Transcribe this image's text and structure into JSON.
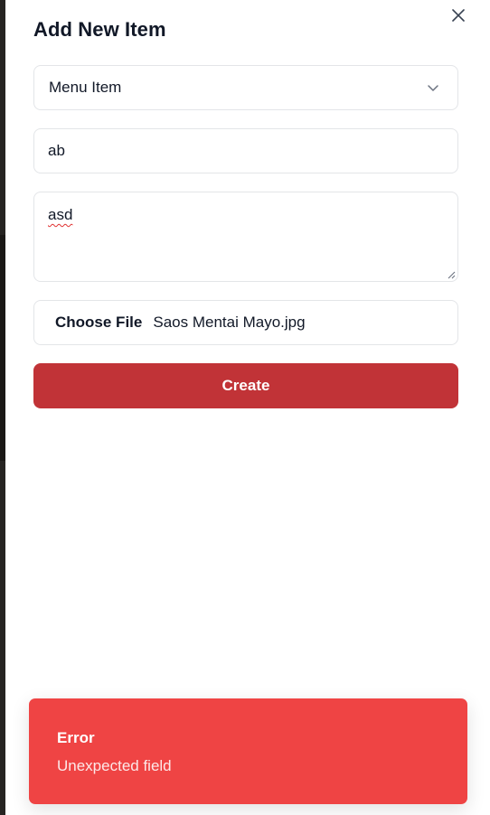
{
  "dialog": {
    "title": "Add New Item",
    "close_icon": "close-icon"
  },
  "form": {
    "type_select": {
      "value": "Menu Item",
      "icon": "chevron-down-icon"
    },
    "name_input": {
      "value": "ab"
    },
    "description_textarea": {
      "value": "asd"
    },
    "image_input": {
      "button_label": "Choose File",
      "file_name": "Saos Mentai Mayo.jpg"
    },
    "submit_label": "Create"
  },
  "toast": {
    "title": "Error",
    "message": "Unexpected field",
    "color": "#ef4444"
  },
  "colors": {
    "primary": "#c13337",
    "panel_bg": "#ffffff",
    "border": "#e3e5e8"
  }
}
